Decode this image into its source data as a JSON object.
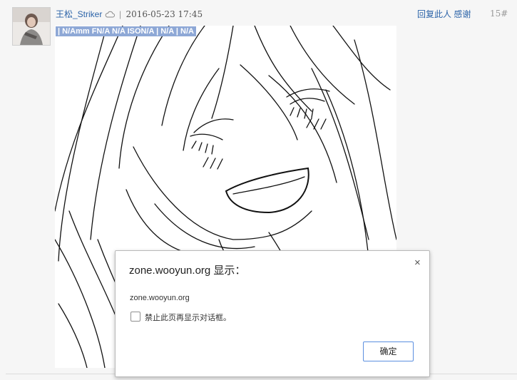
{
  "post": {
    "username": "王松_Striker",
    "separator": "|",
    "timestamp": "2016-05-23 17:45",
    "reply_label": "回复此人",
    "thanks_label": "感谢",
    "floor": "15#",
    "selected_text": "| N/Amm FN/A N/A ISON/A | N/A | N/A"
  },
  "dialog": {
    "title": "zone.wooyun.org 显示：",
    "close_glyph": "×",
    "message": "zone.wooyun.org",
    "checkbox_label": "禁止此页再显示对话框。",
    "checkbox_checked": false,
    "ok_label": "确定"
  },
  "colors": {
    "link": "#2b63a8",
    "selection": "#8ea8d6",
    "ok_border": "#5b8fe0"
  },
  "icons": {
    "user_status": "cloud-icon",
    "close": "close-icon"
  }
}
